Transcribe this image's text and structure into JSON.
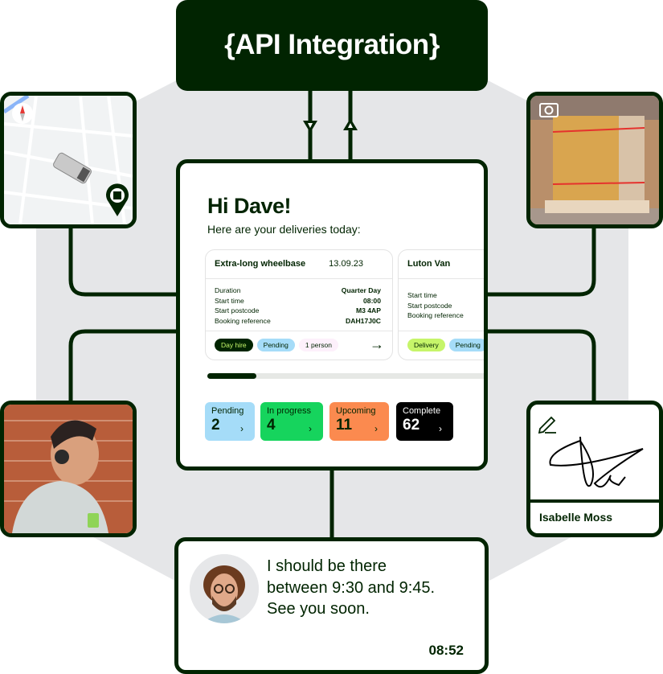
{
  "api": {
    "title": "{API Integration}"
  },
  "colors": {
    "dark_green": "#012401",
    "hex_bg": "#e5e6e8",
    "pending_blue": "#a5dcf8",
    "in_progress_green": "#16d45d",
    "upcoming_orange": "#fb8a4f",
    "complete_black": "#000000",
    "day_hire_bg": "#012401",
    "day_hire_text": "#c6f56a",
    "delivery_bg": "#c6f56a",
    "person_bg": "#fdf0fb"
  },
  "dashboard": {
    "greeting": "Hi Dave!",
    "subtitle": "Here are your deliveries today:",
    "deliveries": [
      {
        "vehicle": "Extra-long wheelbase",
        "date": "13.09.23",
        "rows": [
          {
            "label": "Duration",
            "value": "Quarter Day"
          },
          {
            "label": "Start time",
            "value": "08:00"
          },
          {
            "label": "Start postcode",
            "value": "M3 4AP"
          },
          {
            "label": "Booking reference",
            "value": "DAH17J0C"
          }
        ],
        "tags": [
          "Day hire",
          "Pending",
          "1 person"
        ]
      },
      {
        "vehicle": "Luton Van",
        "rows": [
          {
            "label": "Start time"
          },
          {
            "label": "Start postcode"
          },
          {
            "label": "Booking reference"
          }
        ],
        "tags": [
          "Delivery",
          "Pending"
        ]
      }
    ],
    "scroll_progress_percent": 17,
    "stats": [
      {
        "label": "Pending",
        "count": "2",
        "chevron": "›"
      },
      {
        "label": "In progress",
        "count": "4",
        "chevron": "›"
      },
      {
        "label": "Upcoming",
        "count": "11",
        "chevron": "›"
      },
      {
        "label": "Complete",
        "count": "62",
        "chevron": "›"
      }
    ],
    "arrow_icon": "→"
  },
  "map": {
    "icons": [
      "compass-icon",
      "van-icon",
      "location-pin-icon"
    ]
  },
  "photo": {
    "icon": "camera-icon"
  },
  "signature": {
    "name": "Isabelle Moss",
    "icon": "pen-icon"
  },
  "chat": {
    "message_lines": [
      "I should be there",
      "between 9:30 and 9:45.",
      "See you soon."
    ],
    "time": "08:52"
  }
}
